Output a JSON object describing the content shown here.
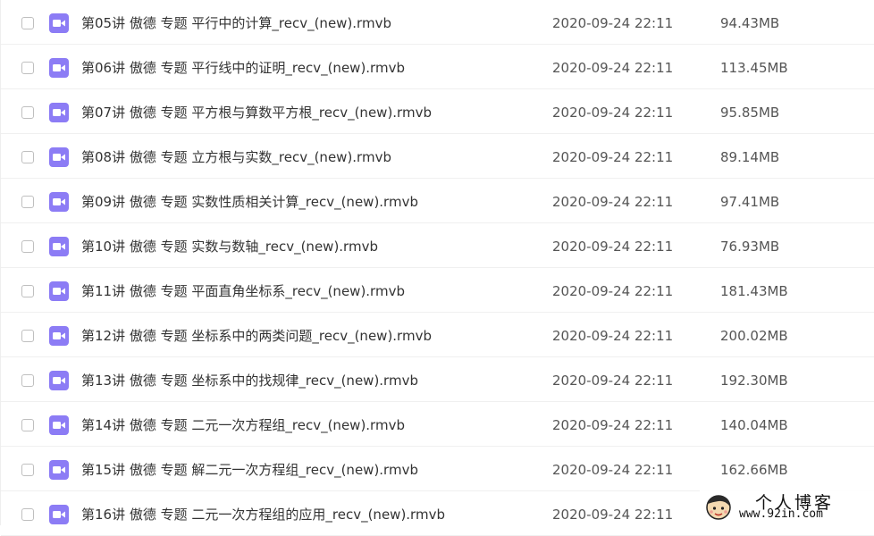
{
  "files": [
    {
      "name": "第05讲 傲德 专题 平行中的计算_recv_(new).rmvb",
      "date": "2020-09-24 22:11",
      "size": "94.43MB"
    },
    {
      "name": "第06讲 傲德 专题 平行线中的证明_recv_(new).rmvb",
      "date": "2020-09-24 22:11",
      "size": "113.45MB"
    },
    {
      "name": "第07讲 傲德 专题 平方根与算数平方根_recv_(new).rmvb",
      "date": "2020-09-24 22:11",
      "size": "95.85MB"
    },
    {
      "name": "第08讲 傲德 专题 立方根与实数_recv_(new).rmvb",
      "date": "2020-09-24 22:11",
      "size": "89.14MB"
    },
    {
      "name": "第09讲 傲德 专题 实数性质相关计算_recv_(new).rmvb",
      "date": "2020-09-24 22:11",
      "size": "97.41MB"
    },
    {
      "name": "第10讲 傲德 专题 实数与数轴_recv_(new).rmvb",
      "date": "2020-09-24 22:11",
      "size": "76.93MB"
    },
    {
      "name": "第11讲 傲德 专题 平面直角坐标系_recv_(new).rmvb",
      "date": "2020-09-24 22:11",
      "size": "181.43MB"
    },
    {
      "name": "第12讲 傲德 专题 坐标系中的两类问题_recv_(new).rmvb",
      "date": "2020-09-24 22:11",
      "size": "200.02MB"
    },
    {
      "name": "第13讲 傲德 专题 坐标系中的找规律_recv_(new).rmvb",
      "date": "2020-09-24 22:11",
      "size": "192.30MB"
    },
    {
      "name": "第14讲 傲德 专题 二元一次方程组_recv_(new).rmvb",
      "date": "2020-09-24 22:11",
      "size": "140.04MB"
    },
    {
      "name": "第15讲 傲德 专题 解二元一次方程组_recv_(new).rmvb",
      "date": "2020-09-24 22:11",
      "size": "162.66MB"
    },
    {
      "name": "第16讲 傲德 专题 二元一次方程组的应用_recv_(new).rmvb",
      "date": "2020-09-24 22:11",
      "size": ""
    }
  ],
  "icon": {
    "name": "video-file-icon",
    "color": "#8c7cf5"
  },
  "watermark": {
    "title": "个人博客",
    "url": "www.92in.com"
  }
}
